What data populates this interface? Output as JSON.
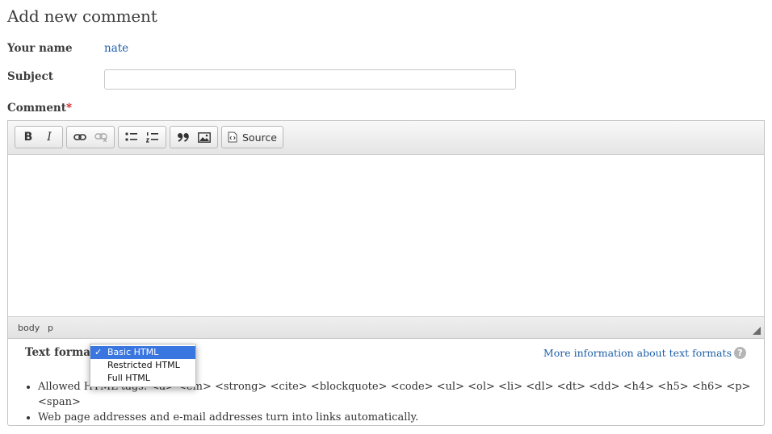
{
  "page": {
    "heading": "Add new comment"
  },
  "form": {
    "name_label": "Your name",
    "name_value": "nate",
    "subject_label": "Subject",
    "subject_value": "",
    "comment_label": "Comment",
    "required_marker": "*"
  },
  "editor": {
    "toolbar": {
      "bold": "B",
      "italic": "I",
      "source_label": "Source"
    },
    "icons": [
      "bold-icon",
      "italic-icon",
      "link-icon",
      "unlink-icon",
      "bulleted-list-icon",
      "numbered-list-icon",
      "blockquote-icon",
      "image-icon",
      "source-icon"
    ],
    "content": "",
    "path": [
      "body",
      "p"
    ]
  },
  "text_format": {
    "label": "Text format",
    "options": [
      "Basic HTML",
      "Restricted HTML",
      "Full HTML"
    ],
    "selected": "Basic HTML",
    "check_mark": "✓",
    "more_info_link": "More information about text formats",
    "help_glyph": "?",
    "tips": [
      "Allowed HTML tags: <a> <em> <strong> <cite> <blockquote> <code> <ul> <ol> <li> <dl> <dt> <dd> <h4> <h5> <h6> <p> <span>",
      "Web page addresses and e-mail addresses turn into links automatically."
    ]
  },
  "colors": {
    "link": "#1f5fa8",
    "required": "#d41c1c",
    "dropdown_selected": "#3a76e0"
  }
}
